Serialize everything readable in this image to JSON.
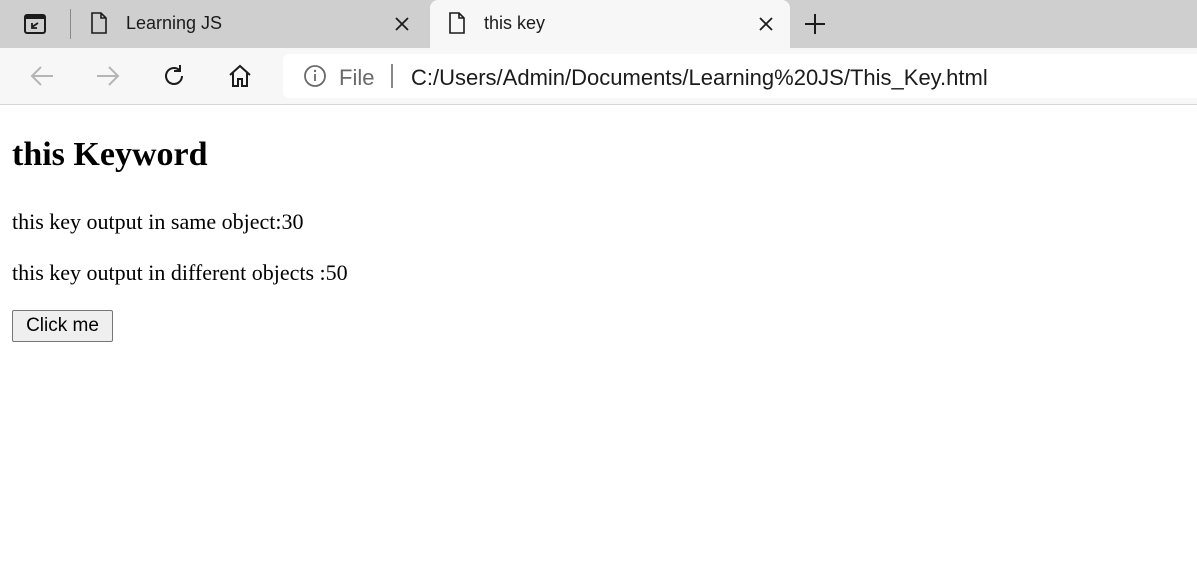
{
  "tabs": [
    {
      "title": "Learning JS",
      "icon": "page-icon",
      "active": false
    },
    {
      "title": "this key",
      "icon": "page-icon",
      "active": true
    }
  ],
  "toolbar": {
    "address": {
      "scheme_label": "File",
      "url": "C:/Users/Admin/Documents/Learning%20JS/This_Key.html"
    }
  },
  "page": {
    "heading": "this Keyword",
    "line1": "this key output in same object:30",
    "line2": "this key output in different objects :50",
    "button_label": "Click me"
  },
  "colors": {
    "tabstrip_bg": "#cfcfcf",
    "active_tab_bg": "#f7f7f7",
    "toolbar_bg": "#f7f7f7",
    "address_bg": "#ffffff"
  }
}
